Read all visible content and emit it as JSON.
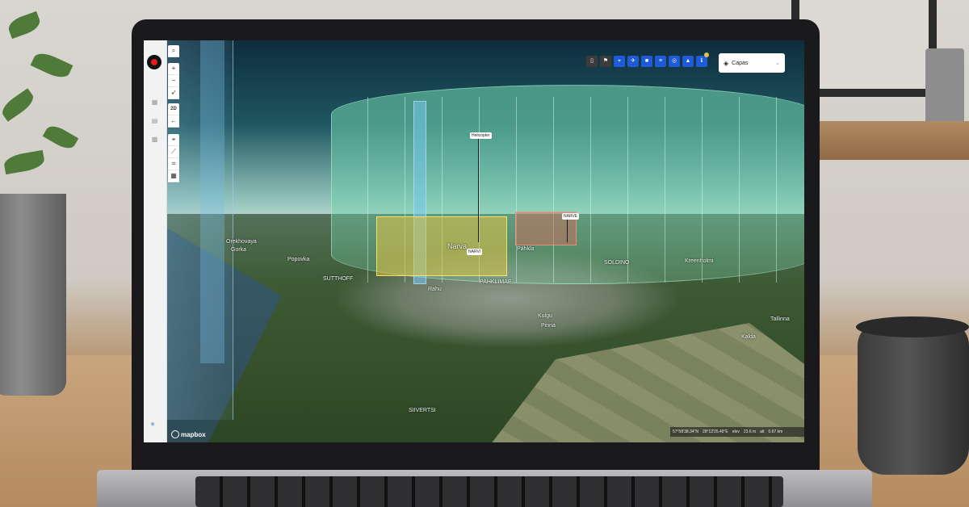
{
  "map": {
    "labels": {
      "narva": "Narva",
      "parkla": "PAHKLIMAE",
      "sutthoff": "SUTTHOFF",
      "popovka": "Popovka",
      "orekhovaya": "Orekhovaya",
      "gorka": "Gorka",
      "rahu": "Rahu",
      "siivertsi": "SIIVERTSI",
      "soldino": "SOLDINO",
      "kulgu": "Kulgu",
      "pinna": "Pinna",
      "kreenholmi": "Kreenholmi",
      "tallinna": "Tallinna",
      "kalda": "Kalda",
      "pahkla": "Pähkla"
    },
    "tags": {
      "helicopter": "Helicopter",
      "narvi": "NARVI",
      "red_tag": "NARVE"
    }
  },
  "toolbar_left": {
    "mode_label": "2D"
  },
  "layers": {
    "label": "Capas"
  },
  "footer": {
    "attribution": "mapbox",
    "lat": "57°58'38.34\"N",
    "lon": "28°12'25.49\"E",
    "elev_label": "elev",
    "elev": "23.6 m",
    "alt_label": "alt",
    "alt": "0.67 km"
  },
  "colors": {
    "accent_blue": "#1f5bd8",
    "record_red": "#e21b1b",
    "zone_green": "#78dcb4",
    "zone_yellow": "#e0c446",
    "zone_red": "#ce6c5c"
  }
}
